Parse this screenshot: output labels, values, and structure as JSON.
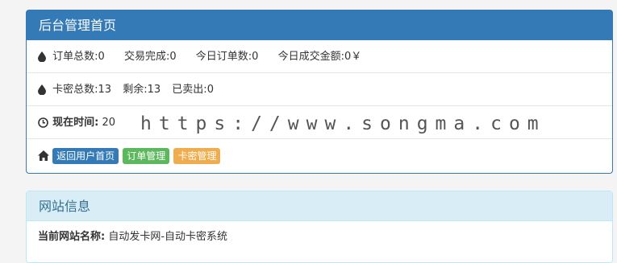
{
  "panel1": {
    "title": "后台管理首页",
    "stats": {
      "orders_total_label": "订单总数:",
      "orders_total_value": "0",
      "trades_done_label": "交易完成:",
      "trades_done_value": "0",
      "today_orders_label": "今日订单数:",
      "today_orders_value": "0",
      "today_amount_label": "今日成交金额:",
      "today_amount_value": "0￥"
    },
    "cards": {
      "total_label": "卡密总数:",
      "total_value": "13",
      "remain_label": "剩余:",
      "remain_value": "13",
      "sold_label": "已卖出:",
      "sold_value": "0"
    },
    "time": {
      "label": "现在时间:",
      "value": "20"
    },
    "buttons": {
      "home": "返回用户首页",
      "orders": "订单管理",
      "cards": "卡密管理"
    }
  },
  "watermark": "https://www.songma.com",
  "panel2": {
    "title": "网站信息",
    "site_name_label": "当前网站名称:",
    "site_name_value": "自动发卡网-自动卡密系统"
  },
  "colors": {
    "primary": "#337ab7",
    "success": "#5cb85c",
    "warning": "#f0ad4e",
    "info_bg": "#d9edf7"
  }
}
